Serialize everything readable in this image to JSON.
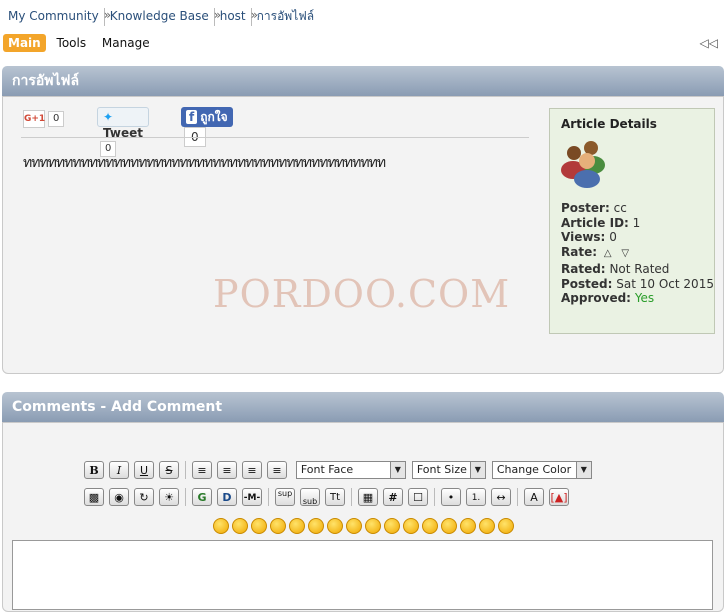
{
  "breadcrumb": [
    "My Community",
    "Knowledge Base",
    "host",
    "การอัพไฟล์"
  ],
  "breadcrumb_sep": "»",
  "nav": {
    "items": [
      "Main",
      "Tools",
      "Manage"
    ],
    "active": "Main",
    "collapse_glyph": "◁◁"
  },
  "article": {
    "title": "การอัพไฟล์",
    "body": "ทททททททททททททททททททททททททททททททททททททททททททท",
    "watermark": "PORDOO.COM"
  },
  "share": {
    "gplus_label": "G+1",
    "gplus_count": "0",
    "tweet_label": "Tweet",
    "tweet_count": "0",
    "fb_label": "ถูกใจ",
    "fb_count": "0"
  },
  "details": {
    "heading": "Article Details",
    "rows": [
      {
        "label": "Poster:",
        "value": "cc"
      },
      {
        "label": "Article ID:",
        "value": "1"
      },
      {
        "label": "Views:",
        "value": "0"
      },
      {
        "label": "Rate:",
        "value": ""
      },
      {
        "label": "Rated:",
        "value": "Not Rated"
      },
      {
        "label": "Posted:",
        "value": "Sat 10 Oct 2015"
      },
      {
        "label": "Approved:",
        "value": "Yes"
      }
    ]
  },
  "comments": {
    "title": "Comments - Add Comment",
    "font_face": "Font Face",
    "font_size": "Font Size",
    "change_color": "Change Color"
  },
  "colors": {
    "accent": "#f3a52a",
    "bar": "#8a9cb3",
    "link": "#2a4f7a",
    "approved": "#2a9d2a"
  }
}
